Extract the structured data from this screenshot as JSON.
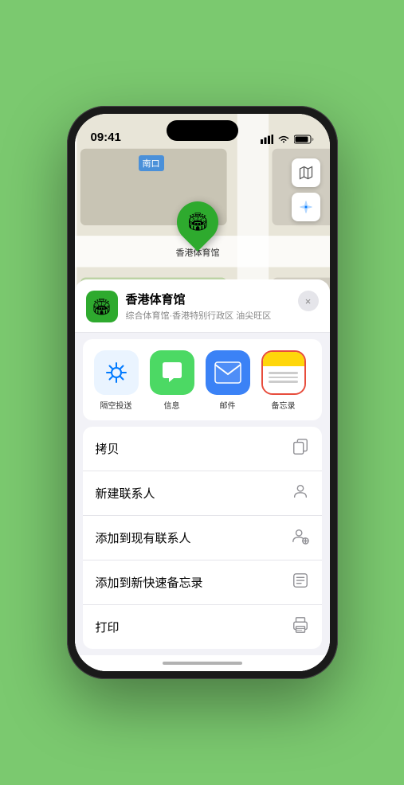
{
  "statusBar": {
    "time": "09:41",
    "locationIcon": "▶",
    "signalBars": "▌▌▌",
    "wifi": "wifi",
    "battery": "battery"
  },
  "map": {
    "label": "南口",
    "pinLabel": "香港体育馆",
    "controls": {
      "mapViewIcon": "🗺",
      "locationIcon": "➤"
    }
  },
  "venueCard": {
    "name": "香港体育馆",
    "subtitle": "综合体育馆·香港特别行政区 油尖旺区",
    "closeLabel": "×"
  },
  "shareItems": [
    {
      "id": "airdrop",
      "label": "隔空投送",
      "icon": "📡",
      "bgClass": "airdrop"
    },
    {
      "id": "message",
      "label": "信息",
      "icon": "💬",
      "bgClass": "message"
    },
    {
      "id": "mail",
      "label": "邮件",
      "icon": "✉",
      "bgClass": "mail"
    },
    {
      "id": "notes",
      "label": "备忘录",
      "icon": "notes",
      "bgClass": "notes"
    }
  ],
  "actions": [
    {
      "label": "拷贝",
      "icon": "📋"
    },
    {
      "label": "新建联系人",
      "icon": "👤"
    },
    {
      "label": "添加到现有联系人",
      "icon": "👤+"
    },
    {
      "label": "添加到新快速备忘录",
      "icon": "📝"
    },
    {
      "label": "打印",
      "icon": "🖨"
    }
  ]
}
